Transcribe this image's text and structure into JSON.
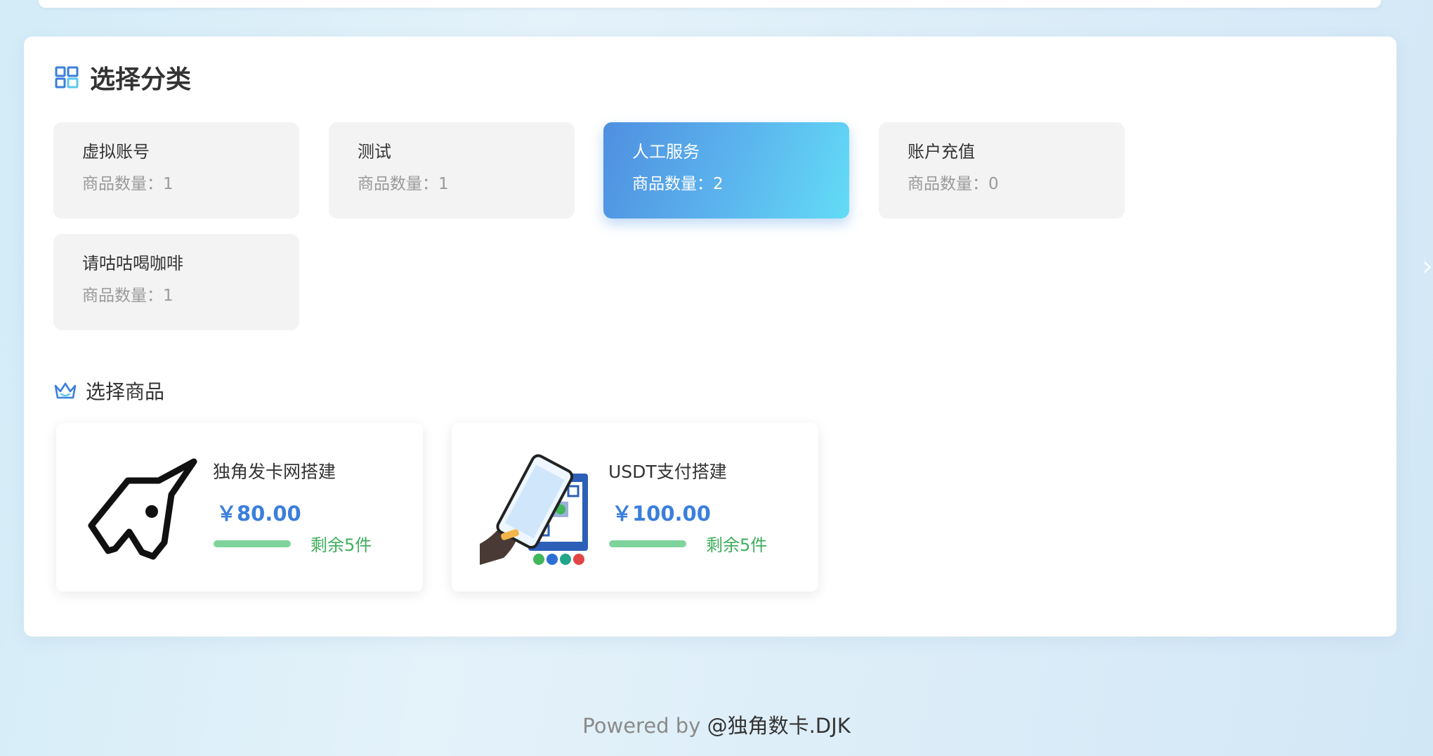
{
  "category_section": {
    "title": "选择分类",
    "categories": [
      {
        "name": "虚拟账号",
        "count": "商品数量：1"
      },
      {
        "name": "测试",
        "count": "商品数量：1"
      },
      {
        "name": "人工服务",
        "count": "商品数量：2",
        "active": true
      },
      {
        "name": "账户充值",
        "count": "商品数量：0"
      },
      {
        "name": "请咕咕喝咖啡",
        "count": "商品数量：1"
      }
    ]
  },
  "goods_section": {
    "title": "选择商品",
    "goods": [
      {
        "name": "独角发卡网搭建",
        "price": "￥80.00",
        "stock": "剩余5件",
        "image_icon": "unicorn-logo-icon"
      },
      {
        "name": "USDT支付搭建",
        "price": "￥100.00",
        "stock": "剩余5件",
        "image_icon": "phone-qr-payment-icon"
      }
    ]
  },
  "footer": {
    "powered_by": "Powered by ",
    "brand": "@独角数卡.DJK"
  },
  "colors": {
    "accent": "#3b7fdc",
    "active_gradient_start": "#4f8fe0",
    "active_gradient_end": "#63dcf6",
    "stock": "#3fae5d"
  }
}
